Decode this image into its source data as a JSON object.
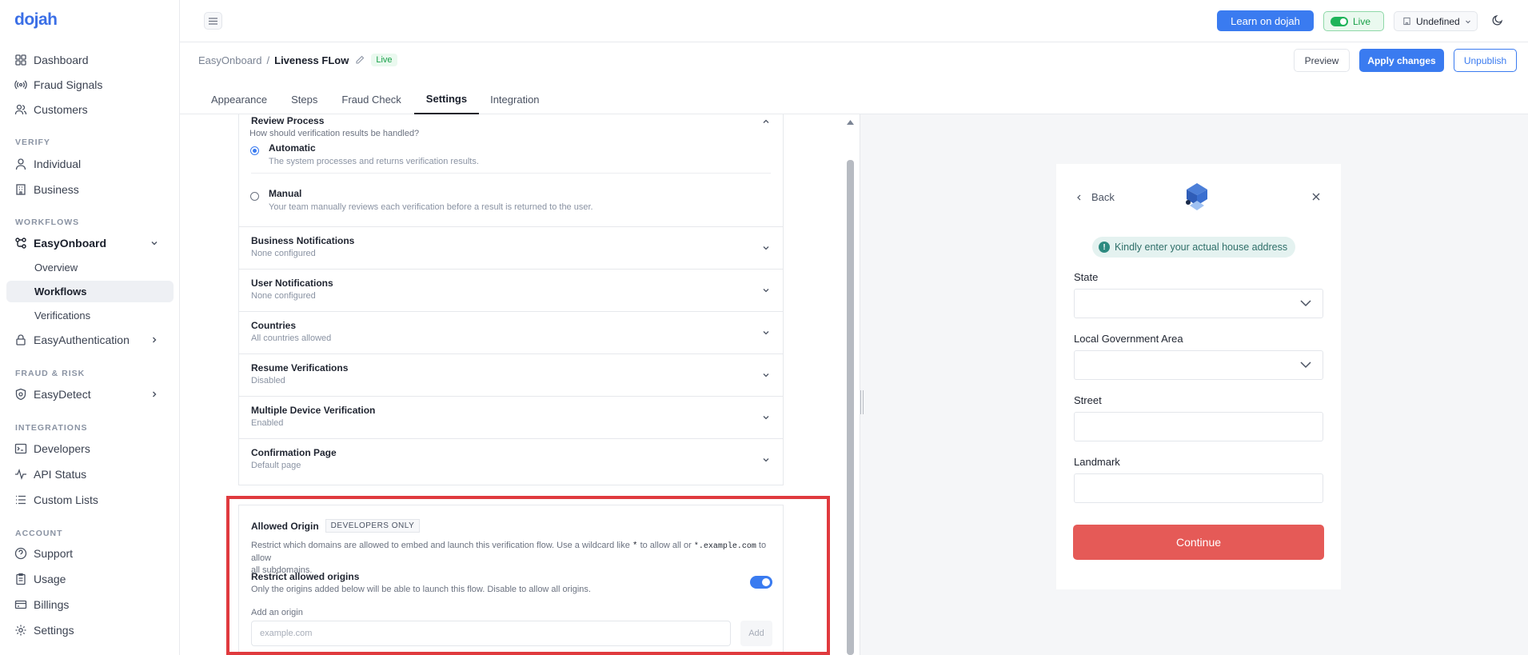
{
  "brand": {
    "logo": "dojah"
  },
  "sidebar": {
    "items": [
      {
        "label": "Dashboard"
      },
      {
        "label": "Fraud Signals"
      },
      {
        "label": "Customers"
      }
    ],
    "sections": {
      "verify": "VERIFY",
      "workflows": "WORKFLOWS",
      "fraud": "FRAUD & RISK",
      "integrations": "INTEGRATIONS",
      "account": "ACCOUNT"
    },
    "verify": [
      {
        "label": "Individual"
      },
      {
        "label": "Business"
      }
    ],
    "workflows": {
      "label": "EasyOnboard",
      "subs": [
        {
          "label": "Overview"
        },
        {
          "label": "Workflows"
        },
        {
          "label": "Verifications"
        }
      ],
      "auth": "EasyAuthentication"
    },
    "fraud": [
      {
        "label": "EasyDetect"
      }
    ],
    "integrations": [
      {
        "label": "Developers"
      },
      {
        "label": "API Status"
      },
      {
        "label": "Custom Lists"
      }
    ],
    "account": [
      {
        "label": "Support"
      },
      {
        "label": "Usage"
      },
      {
        "label": "Billings"
      },
      {
        "label": "Settings"
      }
    ]
  },
  "topbar": {
    "learn": "Learn on dojah",
    "live": "Live",
    "env": "Undefined"
  },
  "header": {
    "crumb_root": "EasyOnboard",
    "crumb_sep": "/",
    "crumb_current": "Liveness FLow",
    "status": "Live",
    "preview": "Preview",
    "apply": "Apply changes",
    "unpublish": "Unpublish"
  },
  "tabs": [
    {
      "label": "Appearance"
    },
    {
      "label": "Steps"
    },
    {
      "label": "Fraud Check"
    },
    {
      "label": "Settings"
    },
    {
      "label": "Integration"
    }
  ],
  "review": {
    "title": "Review Process",
    "question": "How should verification results be handled?",
    "auto": {
      "label": "Automatic",
      "desc": "The system processes and returns verification results."
    },
    "manual": {
      "label": "Manual",
      "desc": "Your team manually reviews each verification before a result is returned to the user."
    }
  },
  "sections": [
    {
      "title": "Business Notifications",
      "sub": "None configured"
    },
    {
      "title": "User Notifications",
      "sub": "None configured"
    },
    {
      "title": "Countries",
      "sub": "All countries allowed"
    },
    {
      "title": "Resume Verifications",
      "sub": "Disabled"
    },
    {
      "title": "Multiple Device Verification",
      "sub": "Enabled"
    },
    {
      "title": "Confirmation Page",
      "sub": "Default page"
    }
  ],
  "origin": {
    "title": "Allowed Origin",
    "badge": "DEVELOPERS ONLY",
    "desc1": "Restrict which domains are allowed to embed and launch this verification flow. Use a wildcard like",
    "code1": "*",
    "desc2": "to allow all or",
    "code2": "*.example.com",
    "desc3": "to allow",
    "desc4": "all subdomains.",
    "restrict_title": "Restrict allowed origins",
    "restrict_desc": "Only the origins added below will be able to launch this flow. Disable to allow all origins.",
    "restrict_on": true,
    "add_label": "Add an origin",
    "placeholder": "example.com",
    "add_btn": "Add"
  },
  "preview": {
    "back": "Back",
    "notice": "Kindly enter your actual house address",
    "fields": [
      {
        "label": "State"
      },
      {
        "label": "Local Government Area"
      },
      {
        "label": "Street"
      },
      {
        "label": "Landmark"
      }
    ],
    "continue": "Continue"
  },
  "colors": {
    "accent": "#3a7bf0",
    "live": "#18a048",
    "continue": "#e55a57",
    "highlight": "#e03a3e"
  }
}
